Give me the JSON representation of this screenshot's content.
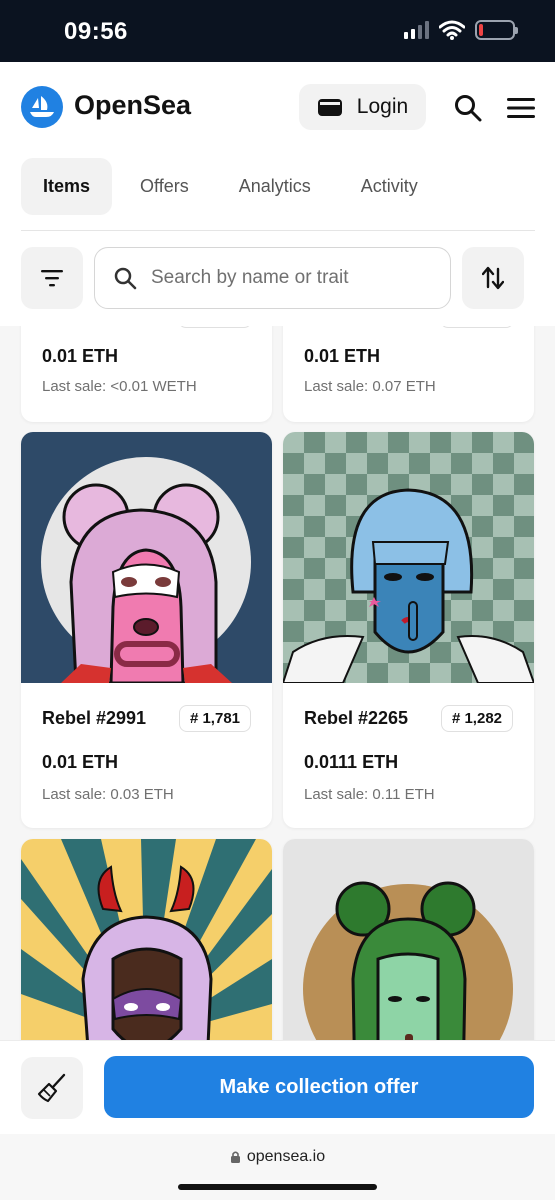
{
  "status_bar": {
    "time": "09:56"
  },
  "header": {
    "brand": "OpenSea",
    "login_label": "Login"
  },
  "tabs": [
    {
      "label": "Items",
      "active": true
    },
    {
      "label": "Offers",
      "active": false
    },
    {
      "label": "Analytics",
      "active": false
    },
    {
      "label": "Activity",
      "active": false
    }
  ],
  "search": {
    "placeholder": "Search by name or trait"
  },
  "cards": [
    {
      "name": "",
      "rank": "",
      "price": "0.01 ETH",
      "last_sale": "Last sale: <0.01 WETH"
    },
    {
      "name": "",
      "rank": "",
      "price": "0.01 ETH",
      "last_sale": "Last sale: 0.07 ETH"
    },
    {
      "name": "Rebel #2991",
      "rank": "# 1,781",
      "price": "0.01 ETH",
      "last_sale": "Last sale: 0.03 ETH"
    },
    {
      "name": "Rebel #2265",
      "rank": "# 1,282",
      "price": "0.0111 ETH",
      "last_sale": "Last sale: 0.11 ETH"
    }
  ],
  "bottom_bar": {
    "offer_label": "Make collection offer"
  },
  "browser": {
    "url": "opensea.io"
  },
  "colors": {
    "accent": "#2081e2",
    "statusbar": "#0b1320"
  }
}
